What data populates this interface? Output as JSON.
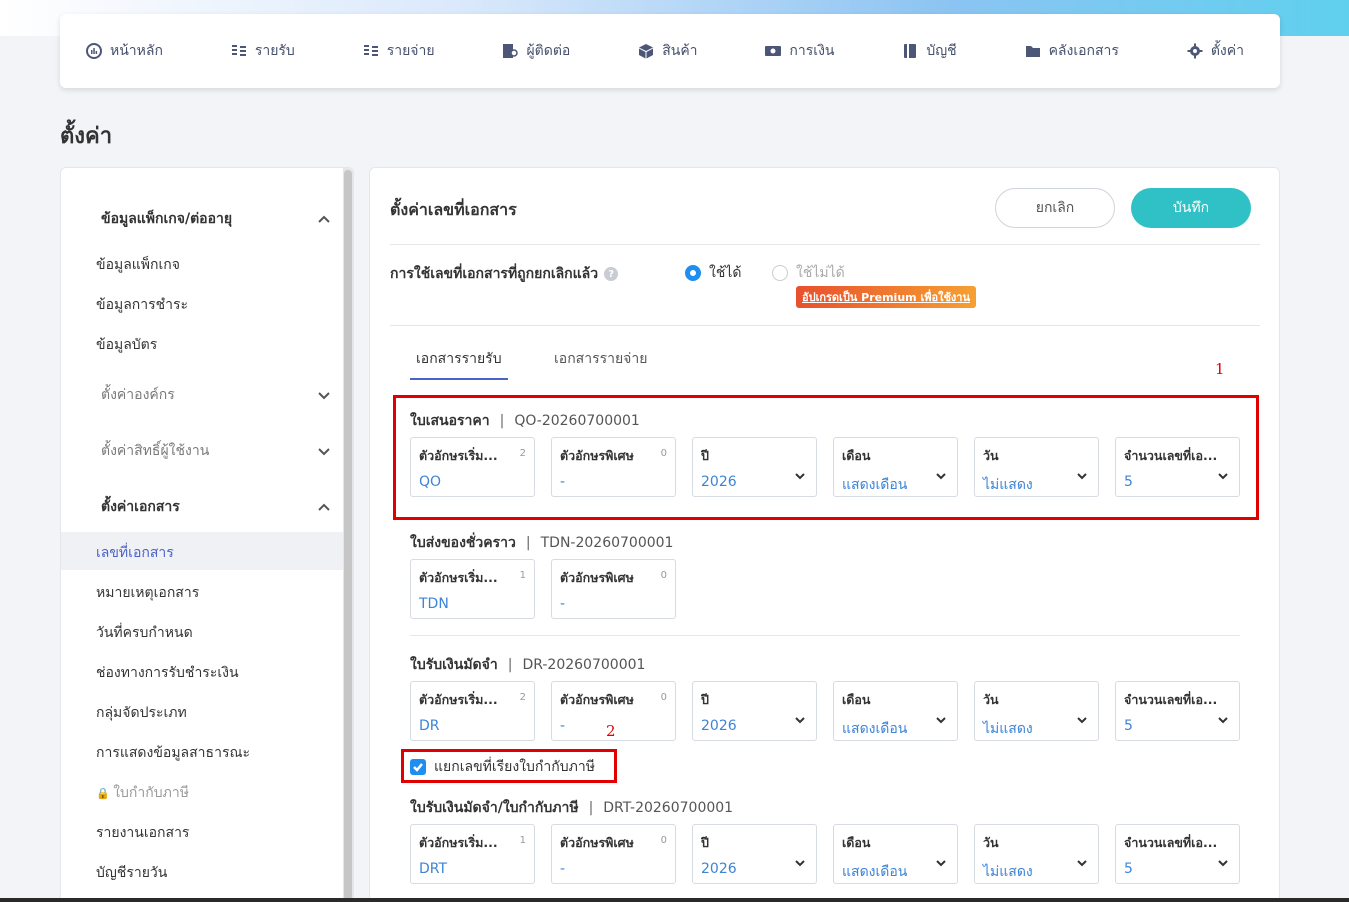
{
  "nav": {
    "items": [
      {
        "label": "หน้าหลัก",
        "icon": "dashboard-icon"
      },
      {
        "label": "รายรับ",
        "icon": "income-icon"
      },
      {
        "label": "รายจ่าย",
        "icon": "expense-icon"
      },
      {
        "label": "ผู้ติดต่อ",
        "icon": "contacts-icon"
      },
      {
        "label": "สินค้า",
        "icon": "box-icon"
      },
      {
        "label": "การเงิน",
        "icon": "money-icon"
      },
      {
        "label": "บัญชี",
        "icon": "book-icon"
      },
      {
        "label": "คลังเอกสาร",
        "icon": "folder-icon"
      },
      {
        "label": "ตั้งค่า",
        "icon": "gear-icon"
      }
    ]
  },
  "page": {
    "title": "ตั้งค่า"
  },
  "sidebar": {
    "section_package": "ข้อมูลแพ็กเกจ/ต่ออายุ",
    "item_package": "ข้อมูลแพ็กเกจ",
    "item_payment": "ข้อมูลการชำระ",
    "item_card": "ข้อมูลบัตร",
    "section_org": "ตั้งค่าองค์กร",
    "section_user": "ตั้งค่าสิทธิ์ผู้ใช้งาน",
    "section_doc": "ตั้งค่าเอกสาร",
    "item_docno": "เลขที่เอกสาร",
    "item_remark": "หมายเหตุเอกสาร",
    "item_due": "วันที่ครบกำหนด",
    "item_channel": "ช่องทางการรับชำระเงิน",
    "item_group": "กลุ่มจัดประเภท",
    "item_public": "การแสดงข้อมูลสาธารณะ",
    "item_taxinv": "ใบกำกับภาษี",
    "item_report": "รายงานเอกสาร",
    "item_daily": "บัญชีรายวัน"
  },
  "panel": {
    "title": "ตั้งค่าเลขที่เอกสาร",
    "cancel": "ยกเลิก",
    "save": "บันทึก",
    "reuse_label": "การใช้เลขที่เอกสารที่ถูกยกเลิกแล้ว",
    "help": "?",
    "opt_yes": "ใช้ได้",
    "opt_no": "ใช้ไม่ได้",
    "premium": "อัปเกรดเป็น Premium เพื่อใช้งาน",
    "tab_income": "เอกสารรายรับ",
    "tab_expense": "เอกสารรายจ่าย",
    "annot1": "1",
    "annot2": "2",
    "separate_label": "แยกเลขที่เรียงใบกำกับภาษี"
  },
  "fields": {
    "prefix": "ตัวอักษรเริ่ม...",
    "special": "ตัวอักษรพิเศษ",
    "year": "ปี",
    "month": "เดือน",
    "day": "วัน",
    "digits": "จำนวนเลขที่เอ..."
  },
  "docs": [
    {
      "name": "ใบเสนอราคา",
      "code": "QO-20260700001",
      "prefix": "QO",
      "prefix_count": "2",
      "special": "-",
      "special_count": "0",
      "year": "2026",
      "month": "แสดงเดือน",
      "day": "ไม่แสดง",
      "digits": "5"
    },
    {
      "name": "ใบส่งของชั่วคราว",
      "code": "TDN-20260700001",
      "prefix": "TDN",
      "prefix_count": "1",
      "special": "-",
      "special_count": "0"
    },
    {
      "name": "ใบรับเงินมัดจำ",
      "code": "DR-20260700001",
      "prefix": "DR",
      "prefix_count": "2",
      "special": "-",
      "special_count": "0",
      "year": "2026",
      "month": "แสดงเดือน",
      "day": "ไม่แสดง",
      "digits": "5"
    },
    {
      "name": "ใบรับเงินมัดจำ/ใบกำกับภาษี",
      "code": "DRT-20260700001",
      "prefix": "DRT",
      "prefix_count": "1",
      "special": "-",
      "special_count": "0",
      "year": "2026",
      "month": "แสดงเดือน",
      "day": "ไม่แสดง",
      "digits": "5"
    }
  ],
  "colors": {
    "accent": "#2fc1c5",
    "link": "#3d84d6",
    "annotation": "#e00000"
  }
}
